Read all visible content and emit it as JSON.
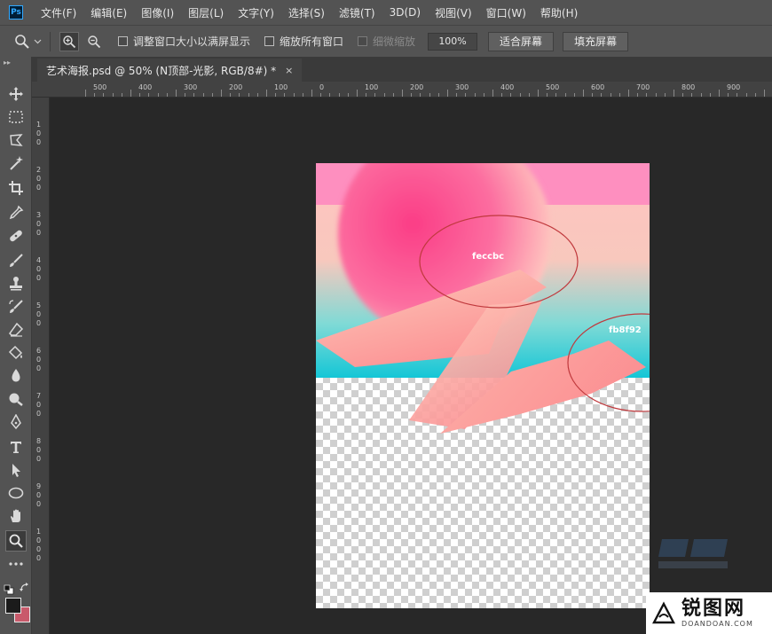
{
  "app": {
    "logo_text": "Ps"
  },
  "menu": [
    "文件(F)",
    "编辑(E)",
    "图像(I)",
    "图层(L)",
    "文字(Y)",
    "选择(S)",
    "滤镜(T)",
    "3D(D)",
    "视图(V)",
    "窗口(W)",
    "帮助(H)"
  ],
  "options": {
    "tool_icon": "zoom-icon",
    "zoom_in_icon": "zoom-in-icon",
    "zoom_out_icon": "zoom-out-icon",
    "resize_windows_label": "调整窗口大小以满屏显示",
    "zoom_all_windows_label": "缩放所有窗口",
    "scrubby_zoom_label": "细微缩放",
    "zoom_value": "100%",
    "fit_screen_label": "适合屏幕",
    "fill_screen_label": "填充屏幕"
  },
  "document": {
    "tab_title": "艺术海报.psd @ 50% (N顶部-光影, RGB/8#) *",
    "close_glyph": "×"
  },
  "ruler": {
    "h_labels": [
      "500",
      "400",
      "300",
      "200",
      "100",
      "0",
      "100",
      "200",
      "300",
      "400",
      "500",
      "600",
      "700",
      "800",
      "900"
    ],
    "v_labels": [
      "100",
      "200",
      "300",
      "400",
      "500",
      "600",
      "700",
      "800",
      "900",
      "1000"
    ]
  },
  "tools": [
    "move-icon",
    "marquee-icon",
    "lasso-icon",
    "magic-wand-icon",
    "crop-icon",
    "eyedropper-icon",
    "healing-brush-icon",
    "brush-icon",
    "stamp-icon",
    "history-brush-icon",
    "eraser-icon",
    "paint-bucket-icon",
    "blur-icon",
    "dodge-icon",
    "pen-icon",
    "type-icon",
    "path-select-icon",
    "ellipse-icon",
    "hand-icon",
    "zoom-icon",
    "more-tools-icon"
  ],
  "swatches": {
    "foreground": "#1b1b1b",
    "background": "#c95a6b"
  },
  "annotations": {
    "top": "feccbc",
    "right": "fb8f92"
  },
  "colors": {
    "pink_band": "#fe8fbf",
    "cyan": "#1cc9d8",
    "peach": "#feccbc",
    "coral": "#fb8f92",
    "circle_stroke": "#c0393d"
  },
  "watermark": {
    "title": "锐图网",
    "subtitle": "DOANDOAN.COM"
  }
}
